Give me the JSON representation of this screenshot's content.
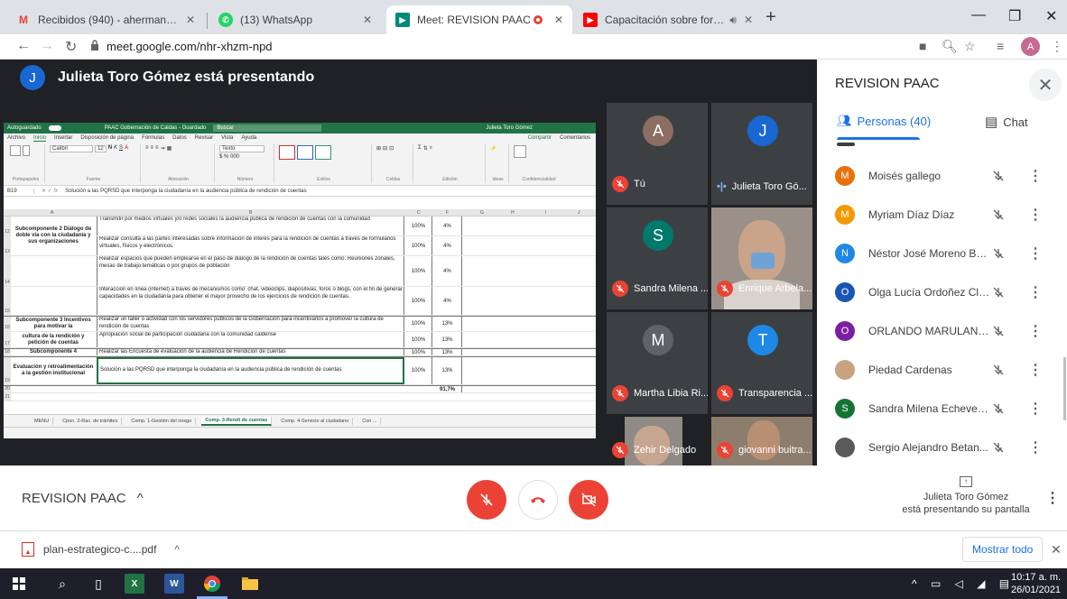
{
  "browser": {
    "tabs": [
      {
        "label": "Recibidos (940) - ahermandez@g",
        "icon": "gmail-icon",
        "active": false
      },
      {
        "label": "(13) WhatsApp",
        "icon": "whatsapp-icon",
        "active": false
      },
      {
        "label": "Meet: REVISION PAAC",
        "icon": "meet-icon",
        "active": true
      },
      {
        "label": "Capacitación sobre formulac",
        "icon": "youtube-icon",
        "active": false
      }
    ],
    "url": "meet.google.com/nhr-xhzm-npd",
    "profile_initial": "A"
  },
  "meet": {
    "presenter_initial": "J",
    "presenter_text": "Julieta Toro Gómez está presentando",
    "meeting_name": "REVISION PAAC",
    "presenting_status_name": "Julieta Toro Gómez",
    "presenting_status_text": "está presentando su pantalla",
    "tiles": [
      {
        "name": "Tú",
        "initial": "A",
        "color": "#8d6e63",
        "muted": true
      },
      {
        "name": "Julieta Toro Gó...",
        "initial": "J",
        "color": "#1967d2",
        "muted": false
      },
      {
        "name": "Sandra Milena ...",
        "initial": "S",
        "color": "#00796b",
        "muted": true
      },
      {
        "name": "Enrique Arbela...",
        "initial": "",
        "color": "#6b6b6b",
        "muted": true
      },
      {
        "name": "Martha Libia Ri...",
        "initial": "M",
        "color": "#5f6368",
        "muted": true
      },
      {
        "name": "Transparencia ...",
        "initial": "T",
        "color": "#1e88e5",
        "muted": true
      },
      {
        "name": "Zehir Delgado",
        "initial": "",
        "color": "#7a7a7a",
        "muted": true
      },
      {
        "name": "giovanni buitra...",
        "initial": "",
        "color": "#8a7a6a",
        "muted": true
      }
    ]
  },
  "excel": {
    "title": "PAAC Gobernación de Caldas - Guardado",
    "search": "Buscar",
    "user": "Julieta Toro Gómez",
    "autosave": "Autoguardado",
    "menu": [
      "Archivo",
      "Inicio",
      "Insertar",
      "Disposición de página",
      "Fórmulas",
      "Datos",
      "Revisar",
      "Vista",
      "Ayuda"
    ],
    "share": "Compartir",
    "comments": "Comentarios",
    "ribbon_groups": [
      "Portapapeles",
      "Fuente",
      "Alineación",
      "Número",
      "Estilos",
      "Celdas",
      "Edición",
      "Ideas",
      "Confidencialidad"
    ],
    "font_name": "Calibri",
    "font_size": "12",
    "number_format": "Texto",
    "cell_ref": "B19",
    "formula": "Solución a las PQRSD que interponga la ciudadanía en la audiencia pública de rendición de cuentas",
    "columns": [
      "A",
      "B",
      "C",
      "F",
      "G",
      "H",
      "I",
      "J"
    ],
    "rows": [
      {
        "num": "12",
        "a": "Subcomponente 2 Diálogo de doble vía con la ciudadanía y sus organizaciones",
        "b": "Transmitir por medios virtuales y/o redes sociales la audiencia pública de rendición de cuentas con la comunidad",
        "c": "100%",
        "d": "4%"
      },
      {
        "num": "13",
        "a": "",
        "b": "Realizar consulta a las partes interesadas sobre información de interés para la rendición de cuentas a través de formularios virtuales, físicos y electrónicos.",
        "c": "100%",
        "d": "4%"
      },
      {
        "num": "14",
        "a": "",
        "b": "Realizar espacios que pueden emplearse en el paso de diálogo de la rendición de cuentas tales como: Reuniones zonales, mesas de trabajo temáticas o por grupos de población",
        "c": "100%",
        "d": "4%"
      },
      {
        "num": "15",
        "a": "",
        "b": "Interacción en línea (internet) a través de mecanismos como: chat, videoclips, diapositivas, foros o blogs, con el fin de generar capacidades en la ciudadanía para obtener el mayor provecho de los ejercicios de rendición de cuentas.",
        "c": "100%",
        "d": "4%"
      },
      {
        "num": "16",
        "a": "Subcomponente 3 Incentivos para motivar la",
        "b": "Realizar un taller o actividad con los servidores públicos de la Gobernación para incentivarlos a promover la cultura de rendición de cuentas",
        "c": "100%",
        "d": "13%"
      },
      {
        "num": "17",
        "a": "cultura de la rendición y petición de cuentas",
        "b": "Apropiación social de participación ciudadana con la comunidad caldense",
        "c": "100%",
        "d": "13%"
      },
      {
        "num": "18",
        "a": "Subcomponente 4",
        "b": "Realizar las Encuesta de evaluación de la audiencia de Rendición de cuentas",
        "c": "100%",
        "d": "13%"
      },
      {
        "num": "19",
        "a": "Evaluación y retroalimentación a la gestión institucional",
        "b": "Solución a las PQRSD que interponga la ciudadanía en la audiencia pública de rendición de cuentas",
        "c": "100%",
        "d": "13%"
      },
      {
        "num": "20",
        "a": "",
        "b": "",
        "c": "",
        "d": "91,7%"
      },
      {
        "num": "21",
        "a": "",
        "b": "",
        "c": "",
        "d": ""
      }
    ],
    "sheet_tabs": [
      "MENU",
      "Cpon. 2-Rac. de trámites",
      "Comp. 1-Gestión del riesgo",
      "Comp. 3-Rendi de cuentas",
      "Comp. 4-Servicio al ciudadano",
      "Con ..."
    ],
    "active_sheet": "Comp. 3-Rendi de cuentas"
  },
  "panel": {
    "title": "REVISION PAAC",
    "people_tab": "Personas (40)",
    "chat_tab": "Chat",
    "participants": [
      {
        "name": "Moisés gallego",
        "initial": "M",
        "color": "#e8710a"
      },
      {
        "name": "Myriam Díaz Díaz",
        "initial": "M",
        "color": "#f29900"
      },
      {
        "name": "Néstor José Moreno Bel...",
        "initial": "N",
        "color": "#1e88e5"
      },
      {
        "name": "Olga Lucía Ordoñez Cla...",
        "initial": "O",
        "color": "#1a56b5"
      },
      {
        "name": "ORLANDO MARULAND...",
        "initial": "O",
        "color": "#7b1fa2"
      },
      {
        "name": "Piedad Cardenas",
        "initial": "",
        "color": "#c9a27e"
      },
      {
        "name": "Sandra Milena Echeverr...",
        "initial": "S",
        "color": "#137333"
      },
      {
        "name": "Sergio Alejandro Betan...",
        "initial": "",
        "color": "#5a5a5a"
      }
    ]
  },
  "downloads": {
    "file": "plan-estrategico-c....pdf",
    "show_all": "Mostrar todo"
  },
  "taskbar": {
    "time": "10:17 a. m.",
    "date": "26/01/2021"
  }
}
